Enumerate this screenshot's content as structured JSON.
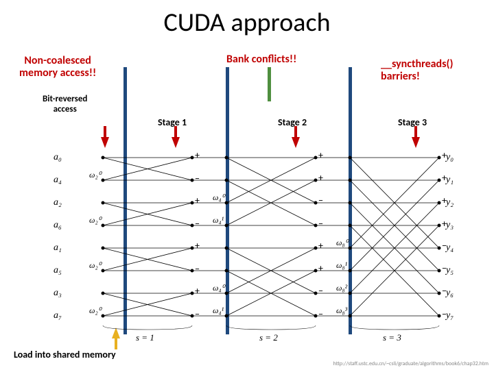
{
  "title": "CUDA approach",
  "annotations": {
    "non_coalesced": "Non-coalesced\nmemory access!!",
    "bit_reversed": "Bit-reversed\naccess",
    "bank_conflicts": "Bank conflicts!!",
    "syncthreads": "__syncthreads()\nbarriers!",
    "load_shared": "Load into shared memory"
  },
  "stages": [
    "Stage 1",
    "Stage 2",
    "Stage 3"
  ],
  "input_labels": [
    "a₀",
    "a₄",
    "a₂",
    "a₆",
    "a₁",
    "a₅",
    "a₃",
    "a₇"
  ],
  "output_labels": [
    "y₀",
    "y₁",
    "y₂",
    "y₃",
    "y₄",
    "y₅",
    "y₆",
    "y₇"
  ],
  "twiddle_s1": [
    "ω₂⁰",
    "ω₂⁰",
    "ω₂⁰",
    "ω₂⁰"
  ],
  "twiddle_s2": [
    "ω₄⁰",
    "ω₄¹",
    "ω₄⁰",
    "ω₄¹"
  ],
  "twiddle_s3": [
    "ω₈⁰",
    "ω₈¹",
    "ω₈²",
    "ω₈³"
  ],
  "stage_marks": [
    "s = 1",
    "s = 2",
    "s = 3"
  ],
  "citation": "http://staff.ustc.edu.cn/~csli/graduate/algorithms/book6/chap32.htm"
}
